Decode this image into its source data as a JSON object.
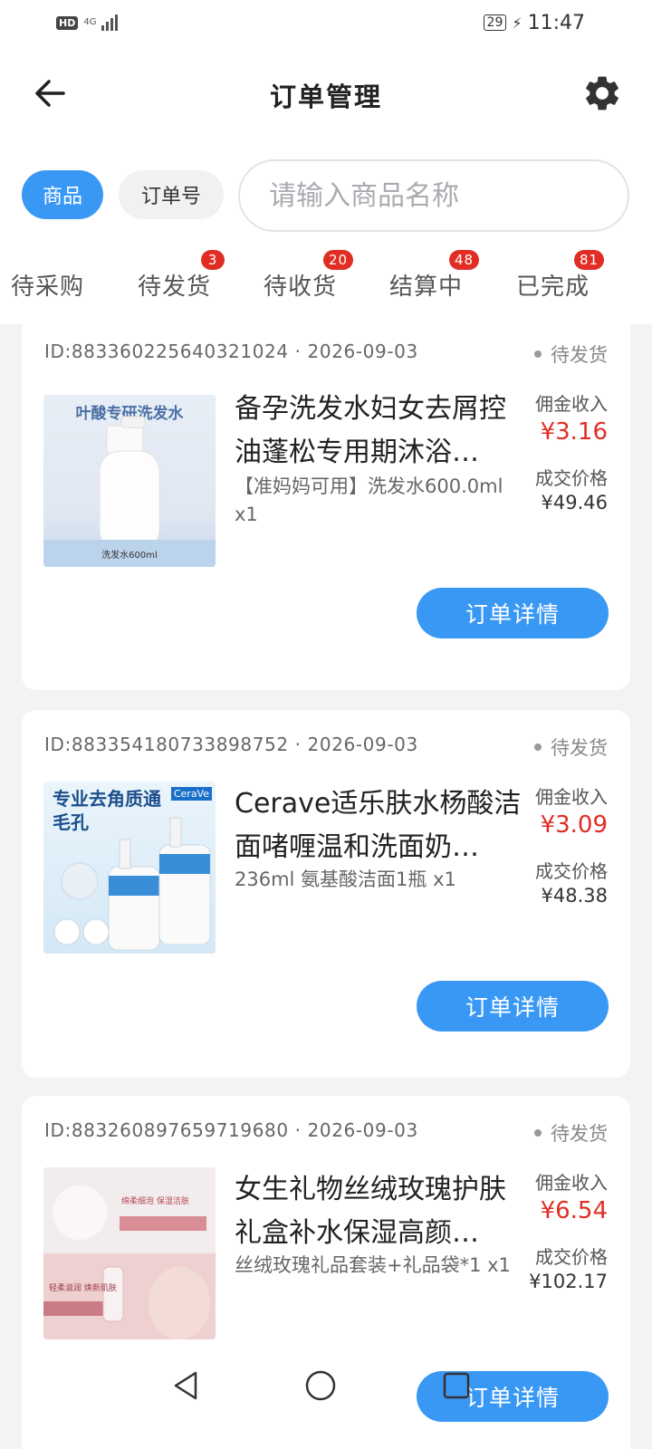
{
  "status_bar": {
    "hd": "HD",
    "net_top": "4G",
    "net_bottom": "ᵢₗ",
    "battery": "29",
    "time": "11:47"
  },
  "header": {
    "title": "订单管理"
  },
  "search": {
    "tab_goods": "商品",
    "tab_order_no": "订单号",
    "placeholder": "请输入商品名称"
  },
  "tabs": [
    {
      "label": "待采购",
      "badge": ""
    },
    {
      "label": "待发货",
      "badge": "3"
    },
    {
      "label": "待收货",
      "badge": "20"
    },
    {
      "label": "结算中",
      "badge": "48"
    },
    {
      "label": "已完成",
      "badge": "81"
    }
  ],
  "orders": [
    {
      "id": "ID:883360225640321024 · 2026-09-03",
      "status": "待发货",
      "title": "备孕洗发水妇女去屑控油蓬松专用期沐浴…",
      "spec": "【准妈妈可用】洗发水600.0ml x1",
      "commission_label": "佣金收入",
      "commission": "¥3.16",
      "price_label": "成交价格",
      "price": "¥49.46",
      "button": "订单详情",
      "thumb_text_top": "叶酸专研洗发水",
      "thumb_text_bottom": "洗发水600ml"
    },
    {
      "id": "ID:883354180733898752 · 2026-09-03",
      "status": "待发货",
      "title": "Cerave适乐肤水杨酸洁面啫喱温和洗面奶…",
      "spec": "236ml 氨基酸洁面1瓶 x1",
      "commission_label": "佣金收入",
      "commission": "¥3.09",
      "price_label": "成交价格",
      "price": "¥48.38",
      "button": "订单详情",
      "thumb_text_top": "专业去角质通毛孔",
      "thumb_text_brand": "CeraVe"
    },
    {
      "id": "ID:883260897659719680 · 2026-09-03",
      "status": "待发货",
      "title": "女生礼物丝绒玫瑰护肤礼盒补水保湿高颜…",
      "spec": "丝绒玫瑰礼品套装+礼品袋*1 x1",
      "commission_label": "佣金收入",
      "commission": "¥6.54",
      "price_label": "成交价格",
      "price": "¥102.17",
      "button": "订单详情",
      "thumb_text_top": "绵柔细泡 保湿洁肤",
      "thumb_text_bottom": "轻柔滋润 焕新肌肤"
    }
  ]
}
